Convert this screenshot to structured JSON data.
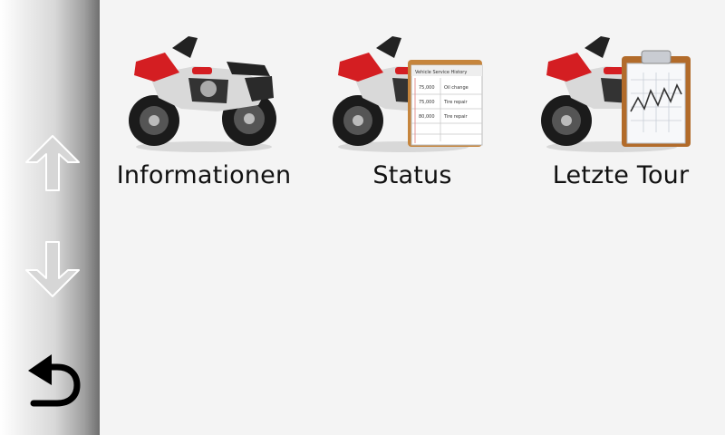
{
  "sidebar": {
    "up_icon": "arrow-up-icon",
    "down_icon": "arrow-down-icon",
    "back_icon": "back-arrow-icon"
  },
  "tiles": [
    {
      "label": "Informationen",
      "icon": "motorcycle-icon"
    },
    {
      "label": "Status",
      "icon": "motorcycle-service-history-icon"
    },
    {
      "label": "Letzte Tour",
      "icon": "motorcycle-chart-icon"
    }
  ],
  "status_sheet": {
    "title": "Vehicle Service History",
    "rows": [
      [
        "75,000",
        "Oil change"
      ],
      [
        "75,000",
        "Tire repair"
      ],
      [
        "80,000",
        "Tire repair"
      ]
    ]
  },
  "colors": {
    "accent_red": "#d41e22",
    "arrow_gray": "#cfcfcf",
    "back_black": "#000000"
  }
}
